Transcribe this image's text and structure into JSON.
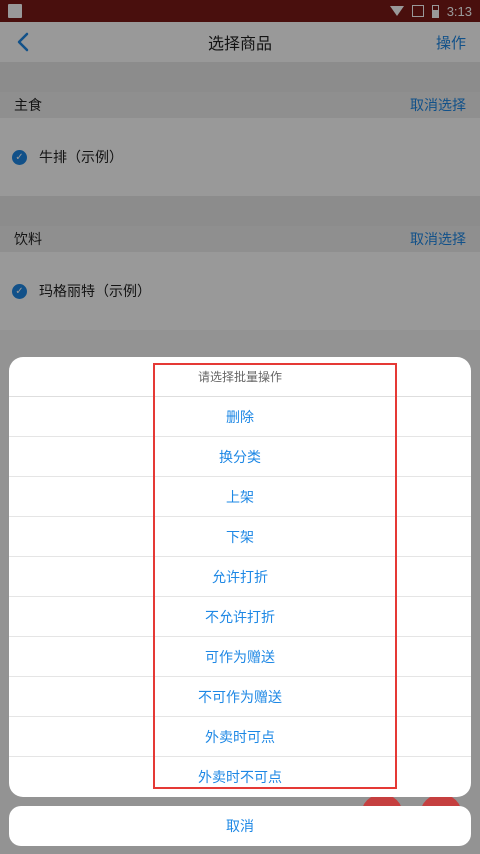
{
  "status_bar": {
    "time": "3:13"
  },
  "nav": {
    "title": "选择商品",
    "action": "操作"
  },
  "sections": [
    {
      "title": "主食",
      "cancel_label": "取消选择",
      "item": "牛排（示例）"
    },
    {
      "title": "饮料",
      "cancel_label": "取消选择",
      "item": "玛格丽特（示例）"
    }
  ],
  "batch_menu": {
    "title": "请选择批量操作",
    "options": [
      "删除",
      "换分类",
      "上架",
      "下架",
      "允许打折",
      "不允许打折",
      "可作为赠送",
      "不可作为赠送",
      "外卖时可点",
      "外卖时不可点"
    ],
    "cancel_label": "取消"
  },
  "colors": {
    "status_bar": "#7a1a17",
    "accent": "#1e88e5",
    "highlight": "#e53935"
  },
  "icons": [
    "back-icon",
    "wifi-icon",
    "signal-icon",
    "battery-icon",
    "check-icon"
  ]
}
